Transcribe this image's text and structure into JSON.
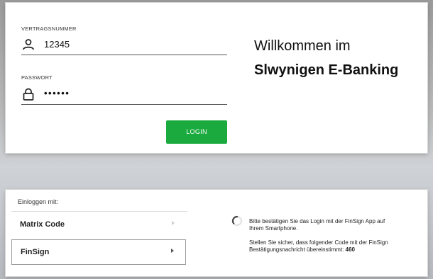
{
  "login": {
    "contract_label": "VERTRAGSNUMMER",
    "contract_value": "12345",
    "password_label": "PASSWORT",
    "password_value": "••••••",
    "button_label": "LOGIN",
    "welcome_line1": "Willkommen im",
    "welcome_line2": "Slwynigen E-Banking"
  },
  "methods": {
    "heading": "Einloggen mit:",
    "items": [
      {
        "label": "Matrix Code",
        "selected": false
      },
      {
        "label": "FinSign",
        "selected": true
      }
    ]
  },
  "finsign_info": {
    "line1a": "Bitte bestätigen Sie das Login mit der FinSign App auf",
    "line1b": "Ihrem Smartphone.",
    "line2a": "Stellen Sie sicher, dass folgender Code mit der FinSign",
    "line2b": "Bestätigungsnachricht übereinstimmt:",
    "code": "460"
  },
  "colors": {
    "accent": "#1aaa3e"
  }
}
